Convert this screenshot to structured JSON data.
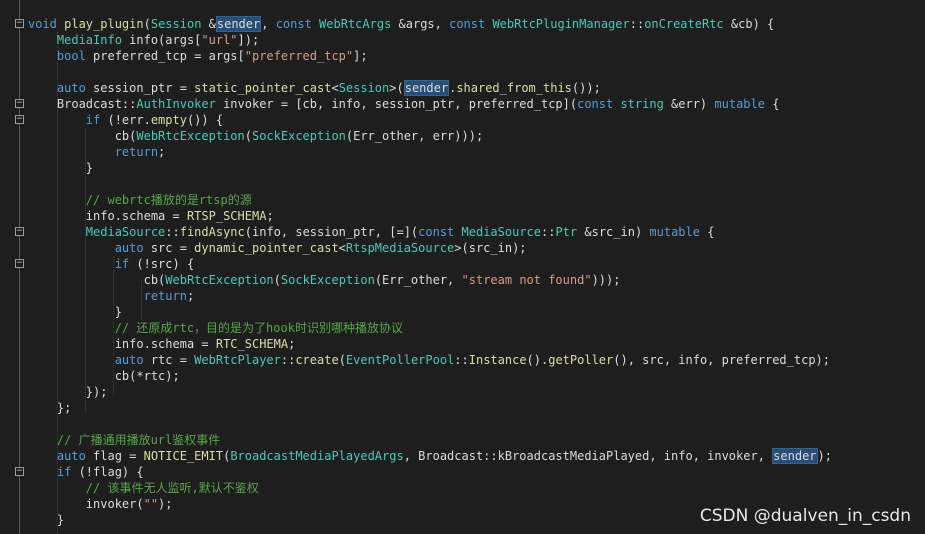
{
  "lines": [
    {
      "fold": "",
      "tokens": [
        {
          "t": "",
          "c": "id"
        }
      ]
    },
    {
      "fold": "−",
      "tokens": [
        {
          "t": "void ",
          "c": "kw"
        },
        {
          "t": "play_plugin",
          "c": "fn"
        },
        {
          "t": "(",
          "c": "id"
        },
        {
          "t": "Session",
          "c": "ty"
        },
        {
          "t": " &",
          "c": "id"
        },
        {
          "t": "sender",
          "c": "id",
          "hl": true
        },
        {
          "t": ", ",
          "c": "id"
        },
        {
          "t": "const ",
          "c": "kw"
        },
        {
          "t": "WebRtcArgs",
          "c": "ty"
        },
        {
          "t": " &args, ",
          "c": "id"
        },
        {
          "t": "const ",
          "c": "kw"
        },
        {
          "t": "WebRtcPluginManager",
          "c": "ty"
        },
        {
          "t": "::",
          "c": "id"
        },
        {
          "t": "onCreateRtc",
          "c": "ty"
        },
        {
          "t": " &cb) {",
          "c": "id"
        }
      ]
    },
    {
      "fold": "",
      "tokens": [
        {
          "t": "    MediaInfo",
          "c": "ty"
        },
        {
          "t": " info(args[",
          "c": "id"
        },
        {
          "t": "\"url\"",
          "c": "st"
        },
        {
          "t": "]);",
          "c": "id"
        }
      ]
    },
    {
      "fold": "",
      "tokens": [
        {
          "t": "    bool",
          "c": "kw"
        },
        {
          "t": " preferred_tcp = args[",
          "c": "id"
        },
        {
          "t": "\"preferred_tcp\"",
          "c": "st"
        },
        {
          "t": "];",
          "c": "id"
        }
      ]
    },
    {
      "fold": "",
      "tokens": [
        {
          "t": "",
          "c": "id"
        }
      ]
    },
    {
      "fold": "",
      "tokens": [
        {
          "t": "    auto",
          "c": "kw"
        },
        {
          "t": " session_ptr = ",
          "c": "id"
        },
        {
          "t": "static_pointer_cast",
          "c": "fn"
        },
        {
          "t": "<",
          "c": "id"
        },
        {
          "t": "Session",
          "c": "ty"
        },
        {
          "t": ">(",
          "c": "id"
        },
        {
          "t": "sender",
          "c": "id",
          "hl": true
        },
        {
          "t": ".",
          "c": "id"
        },
        {
          "t": "shared_from_this",
          "c": "fn"
        },
        {
          "t": "());",
          "c": "id"
        }
      ]
    },
    {
      "fold": "−",
      "tokens": [
        {
          "t": "    Broadcast",
          "c": "id"
        },
        {
          "t": "::",
          "c": "id"
        },
        {
          "t": "AuthInvoker",
          "c": "ty"
        },
        {
          "t": " invoker = [cb, info, session_ptr, preferred_tcp](",
          "c": "id"
        },
        {
          "t": "const ",
          "c": "kw"
        },
        {
          "t": "string",
          "c": "ty"
        },
        {
          "t": " &err) ",
          "c": "id"
        },
        {
          "t": "mutable",
          "c": "kw"
        },
        {
          "t": " {",
          "c": "id"
        }
      ]
    },
    {
      "fold": "−",
      "tokens": [
        {
          "t": "        if",
          "c": "kw"
        },
        {
          "t": " (!err.",
          "c": "id"
        },
        {
          "t": "empty",
          "c": "fn"
        },
        {
          "t": "()) {",
          "c": "id"
        }
      ]
    },
    {
      "fold": "",
      "tokens": [
        {
          "t": "            cb(",
          "c": "id"
        },
        {
          "t": "WebRtcException",
          "c": "ty"
        },
        {
          "t": "(",
          "c": "id"
        },
        {
          "t": "SockException",
          "c": "ty"
        },
        {
          "t": "(Err_other, err)));",
          "c": "id"
        }
      ]
    },
    {
      "fold": "",
      "tokens": [
        {
          "t": "            return",
          "c": "kw"
        },
        {
          "t": ";",
          "c": "id"
        }
      ]
    },
    {
      "fold": "",
      "tokens": [
        {
          "t": "        }",
          "c": "id"
        }
      ]
    },
    {
      "fold": "",
      "tokens": [
        {
          "t": "",
          "c": "id"
        }
      ]
    },
    {
      "fold": "",
      "tokens": [
        {
          "t": "        // webrtc播放的是rtsp的源",
          "c": "cm"
        }
      ]
    },
    {
      "fold": "",
      "tokens": [
        {
          "t": "        info.schema = ",
          "c": "id"
        },
        {
          "t": "RTSP_SCHEMA",
          "c": "fn"
        },
        {
          "t": ";",
          "c": "id"
        }
      ]
    },
    {
      "fold": "−",
      "tokens": [
        {
          "t": "        MediaSource",
          "c": "ty"
        },
        {
          "t": "::",
          "c": "id"
        },
        {
          "t": "findAsync",
          "c": "fn"
        },
        {
          "t": "(info, session_ptr, [=](",
          "c": "id"
        },
        {
          "t": "const ",
          "c": "kw"
        },
        {
          "t": "MediaSource",
          "c": "ty"
        },
        {
          "t": "::",
          "c": "id"
        },
        {
          "t": "Ptr",
          "c": "ty"
        },
        {
          "t": " &src_in) ",
          "c": "id"
        },
        {
          "t": "mutable",
          "c": "kw"
        },
        {
          "t": " {",
          "c": "id"
        }
      ]
    },
    {
      "fold": "",
      "tokens": [
        {
          "t": "            auto",
          "c": "kw"
        },
        {
          "t": " src = ",
          "c": "id"
        },
        {
          "t": "dynamic_pointer_cast",
          "c": "fn"
        },
        {
          "t": "<",
          "c": "id"
        },
        {
          "t": "RtspMediaSource",
          "c": "ty"
        },
        {
          "t": ">(src_in);",
          "c": "id"
        }
      ]
    },
    {
      "fold": "−",
      "tokens": [
        {
          "t": "            if",
          "c": "kw"
        },
        {
          "t": " (!src) {",
          "c": "id"
        }
      ]
    },
    {
      "fold": "",
      "tokens": [
        {
          "t": "                cb(",
          "c": "id"
        },
        {
          "t": "WebRtcException",
          "c": "ty"
        },
        {
          "t": "(",
          "c": "id"
        },
        {
          "t": "SockException",
          "c": "ty"
        },
        {
          "t": "(Err_other, ",
          "c": "id"
        },
        {
          "t": "\"stream not found\"",
          "c": "st"
        },
        {
          "t": ")));",
          "c": "id"
        }
      ]
    },
    {
      "fold": "",
      "tokens": [
        {
          "t": "                return",
          "c": "kw"
        },
        {
          "t": ";",
          "c": "id"
        }
      ]
    },
    {
      "fold": "",
      "tokens": [
        {
          "t": "            }",
          "c": "id"
        }
      ]
    },
    {
      "fold": "",
      "tokens": [
        {
          "t": "            // 还原成rtc，目的是为了hook时识别哪种播放协议",
          "c": "cm"
        }
      ]
    },
    {
      "fold": "",
      "tokens": [
        {
          "t": "            info.schema = ",
          "c": "id"
        },
        {
          "t": "RTC_SCHEMA",
          "c": "fn"
        },
        {
          "t": ";",
          "c": "id"
        }
      ]
    },
    {
      "fold": "",
      "tokens": [
        {
          "t": "            auto",
          "c": "kw"
        },
        {
          "t": " rtc = ",
          "c": "id"
        },
        {
          "t": "WebRtcPlayer",
          "c": "ty"
        },
        {
          "t": "::",
          "c": "id"
        },
        {
          "t": "create",
          "c": "fn"
        },
        {
          "t": "(",
          "c": "id"
        },
        {
          "t": "EventPollerPool",
          "c": "ty"
        },
        {
          "t": "::",
          "c": "id"
        },
        {
          "t": "Instance",
          "c": "fn"
        },
        {
          "t": "().",
          "c": "id"
        },
        {
          "t": "getPoller",
          "c": "fn"
        },
        {
          "t": "(), src, info, preferred_tcp);",
          "c": "id"
        }
      ]
    },
    {
      "fold": "",
      "tokens": [
        {
          "t": "            cb(*rtc);",
          "c": "id"
        }
      ]
    },
    {
      "fold": "",
      "tokens": [
        {
          "t": "        });",
          "c": "id"
        }
      ]
    },
    {
      "fold": "",
      "tokens": [
        {
          "t": "    };",
          "c": "id"
        }
      ]
    },
    {
      "fold": "",
      "tokens": [
        {
          "t": "",
          "c": "id"
        }
      ]
    },
    {
      "fold": "",
      "tokens": [
        {
          "t": "    // 广播通用播放url鉴权事件",
          "c": "cm"
        }
      ]
    },
    {
      "fold": "",
      "tokens": [
        {
          "t": "    auto",
          "c": "kw"
        },
        {
          "t": " flag = ",
          "c": "id"
        },
        {
          "t": "NOTICE_EMIT",
          "c": "fn"
        },
        {
          "t": "(",
          "c": "id"
        },
        {
          "t": "BroadcastMediaPlayedArgs",
          "c": "ty"
        },
        {
          "t": ", Broadcast::kBroadcastMediaPlayed, info, invoker, ",
          "c": "id"
        },
        {
          "t": "sender",
          "c": "id",
          "hl": true
        },
        {
          "t": ");",
          "c": "id"
        }
      ]
    },
    {
      "fold": "−",
      "tokens": [
        {
          "t": "    if",
          "c": "kw"
        },
        {
          "t": " (!flag) {",
          "c": "id"
        }
      ]
    },
    {
      "fold": "",
      "tokens": [
        {
          "t": "        // 该事件无人监听,默认不鉴权",
          "c": "cm"
        }
      ]
    },
    {
      "fold": "",
      "tokens": [
        {
          "t": "        invoker(",
          "c": "id"
        },
        {
          "t": "\"\"",
          "c": "st"
        },
        {
          "t": ");",
          "c": "id"
        }
      ]
    },
    {
      "fold": "",
      "tokens": [
        {
          "t": "    }",
          "c": "id"
        }
      ]
    }
  ],
  "watermark": "CSDN @dualven_in_csdn"
}
